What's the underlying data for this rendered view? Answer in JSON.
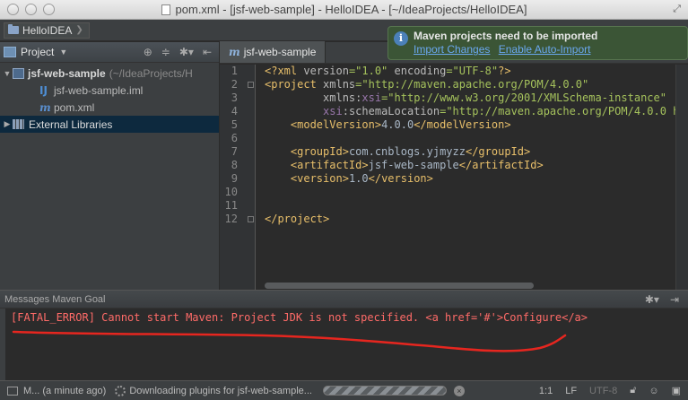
{
  "window": {
    "title": "pom.xml - [jsf-web-sample] - HelloIDEA - [~/IdeaProjects/HelloIDEA]"
  },
  "navbar": {
    "project": "HelloIDEA"
  },
  "project_pane": {
    "view_label": "Project",
    "tree": {
      "root_name": "jsf-web-sample",
      "root_path": "(~/IdeaProjects/H",
      "children": [
        "jsf-web-sample.iml",
        "pom.xml"
      ],
      "external": "External Libraries"
    }
  },
  "editor": {
    "tab_label": "jsf-web-sample",
    "line_numbers": [
      "1",
      "2",
      "3",
      "4",
      "5",
      "6",
      "7",
      "8",
      "9",
      "10",
      "11",
      "12"
    ]
  },
  "notification": {
    "title": "Maven projects need to be imported",
    "link_import": "Import Changes",
    "link_auto": "Enable Auto-Import"
  },
  "messages": {
    "header": "Messages Maven Goal",
    "error": "[FATAL_ERROR] Cannot start Maven: Project JDK is not specified. <a href='#'>Configure</a>"
  },
  "status": {
    "left_text": "M... (a minute ago)",
    "progress_text": "Downloading plugins for jsf-web-sample...",
    "caret": "1:1",
    "line_sep": "LF",
    "encoding": "UTF-8"
  },
  "colors": {
    "error": "#ff6b68",
    "balloon_bg": "#3b5536",
    "link": "#6aa8f0",
    "selection": "#0d293e"
  }
}
